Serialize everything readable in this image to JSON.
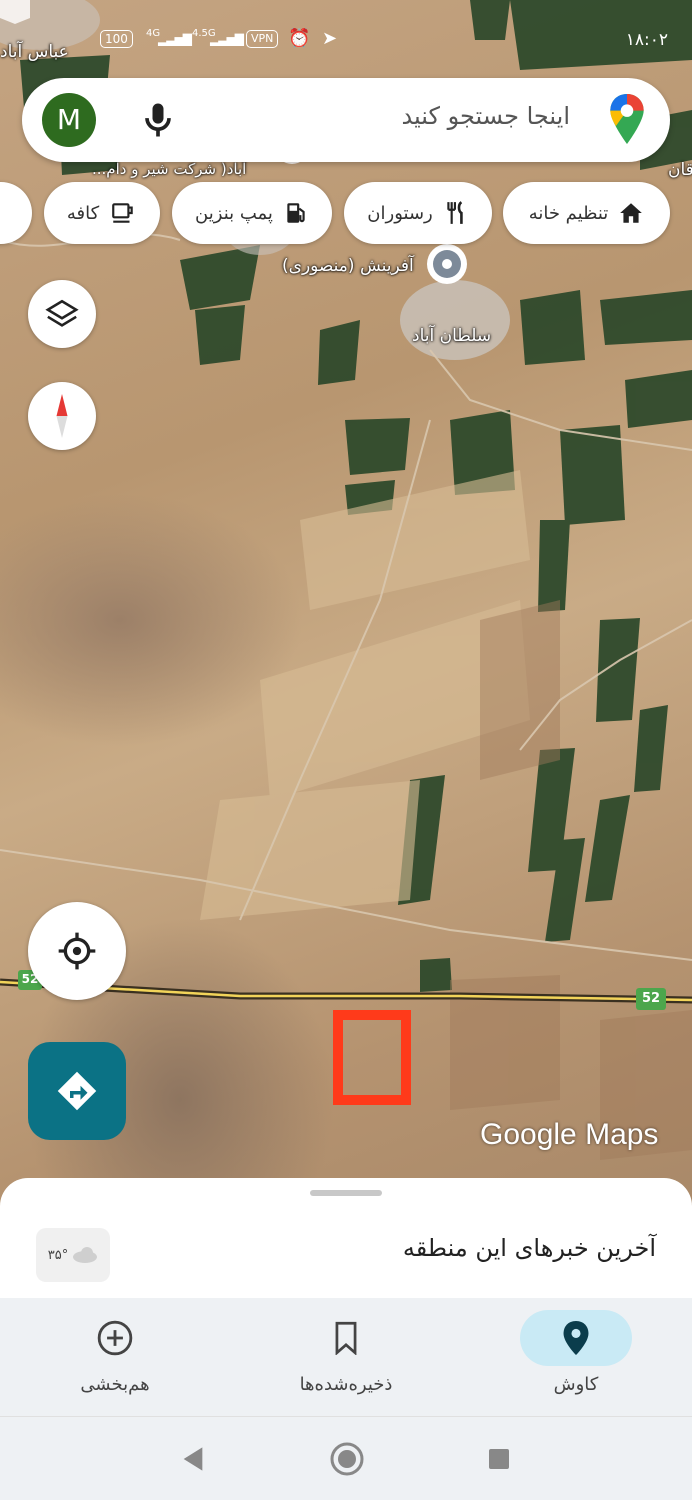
{
  "status_bar": {
    "time": "۱۸:۰۲",
    "battery": "100",
    "network_1": "4G",
    "network_2": "4.5G",
    "vpn": "VPN"
  },
  "search": {
    "avatar_letter": "M",
    "placeholder": "اینجا جستجو کنید"
  },
  "chips": {
    "home": "تنظیم خانه",
    "restaurant": "رستوران",
    "gas": "پمپ بنزین",
    "cafe": "کافه"
  },
  "map": {
    "labels": {
      "abbas_abad": "عباس آباد",
      "factory": "آباد( شرکت شیر و دام...",
      "afarinesh": "آفرینش (منصوری)",
      "soltan_abad": "سلطان آباد",
      "right_edge": "قان"
    },
    "road_shield_left": "52",
    "road_shield_right": "52",
    "watermark": "Google Maps",
    "colors": {
      "marker": "#ff3a1a",
      "road": "#f2d45a",
      "field_green": "#2f4a2c"
    }
  },
  "sheet": {
    "news_title": "آخرین خبرهای این منطقه",
    "weather": "۳۵°"
  },
  "bottom_nav": {
    "explore": "کاوش",
    "saved": "ذخیره‌شده‌ها",
    "contribute": "هم‌بخشی"
  },
  "colors": {
    "accent": "#0b7285",
    "active_nav_bg": "#c9eaf5"
  }
}
